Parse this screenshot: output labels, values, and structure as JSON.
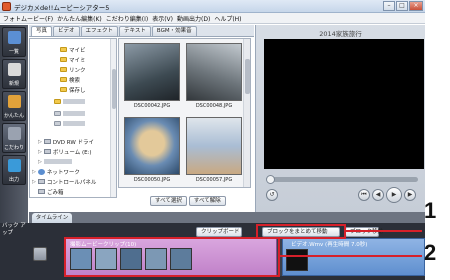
{
  "window": {
    "title": "デジカメde!!ムービーシアター5"
  },
  "menu": [
    "フォトムービー(F)",
    "かんたん編集(K)",
    "こだわり編集(I)",
    "表示(V)",
    "動画出力(D)",
    "ヘルプ(H)"
  ],
  "left_tabs": [
    {
      "label": "一覧",
      "color": "#5b8fd4"
    },
    {
      "label": "新規",
      "color": "#d9d9d9"
    },
    {
      "label": "かんたん",
      "color": "#e2a23a"
    },
    {
      "label": "こだわり",
      "color": "#6b6f78"
    },
    {
      "label": "出力",
      "color": "#3a9ad9"
    }
  ],
  "source_tabs": [
    "写真",
    "ビデオ",
    "エフェクト",
    "テキスト",
    "BGM・効果音"
  ],
  "tree": {
    "items": [
      "マイビ",
      "マイミ",
      "リンク",
      "検索",
      "保存し",
      "DVD RW ドライ",
      "ボリューム (E:)",
      "ネットワーク",
      "コントロールパネル",
      "ごみ箱"
    ]
  },
  "thumbnails": [
    {
      "caption": "DSC00042.JPG",
      "palette": [
        "#6e7f8c",
        "#3d4a52"
      ]
    },
    {
      "caption": "DSC00048.JPG",
      "palette": [
        "#9aa4ab",
        "#4d5358"
      ]
    },
    {
      "caption": "DSC00050.JPG",
      "palette": [
        "#c9b48a",
        "#5a7aa0"
      ]
    },
    {
      "caption": "DSC00057.JPG",
      "palette": [
        "#bfc7cf",
        "#7f9cc0"
      ]
    }
  ],
  "buttons": {
    "select_all": "すべて選択",
    "deselect_all": "すべて解除",
    "clipboard": "クリップボード",
    "block_move": "ブロックをまとめて移動",
    "other_move": "ブロック移動"
  },
  "preview": {
    "title": "2014家族旅行"
  },
  "timeline": {
    "tab_label": "タイムライン",
    "side_label": "バック アップ",
    "clip1_label": "撮影ムービークリップ(10)",
    "clip2_label": "ビデオ.Wmv (再生時間 7.0秒)"
  },
  "callouts": [
    "1",
    "2"
  ],
  "colors": {
    "callout": "#d6202a"
  }
}
